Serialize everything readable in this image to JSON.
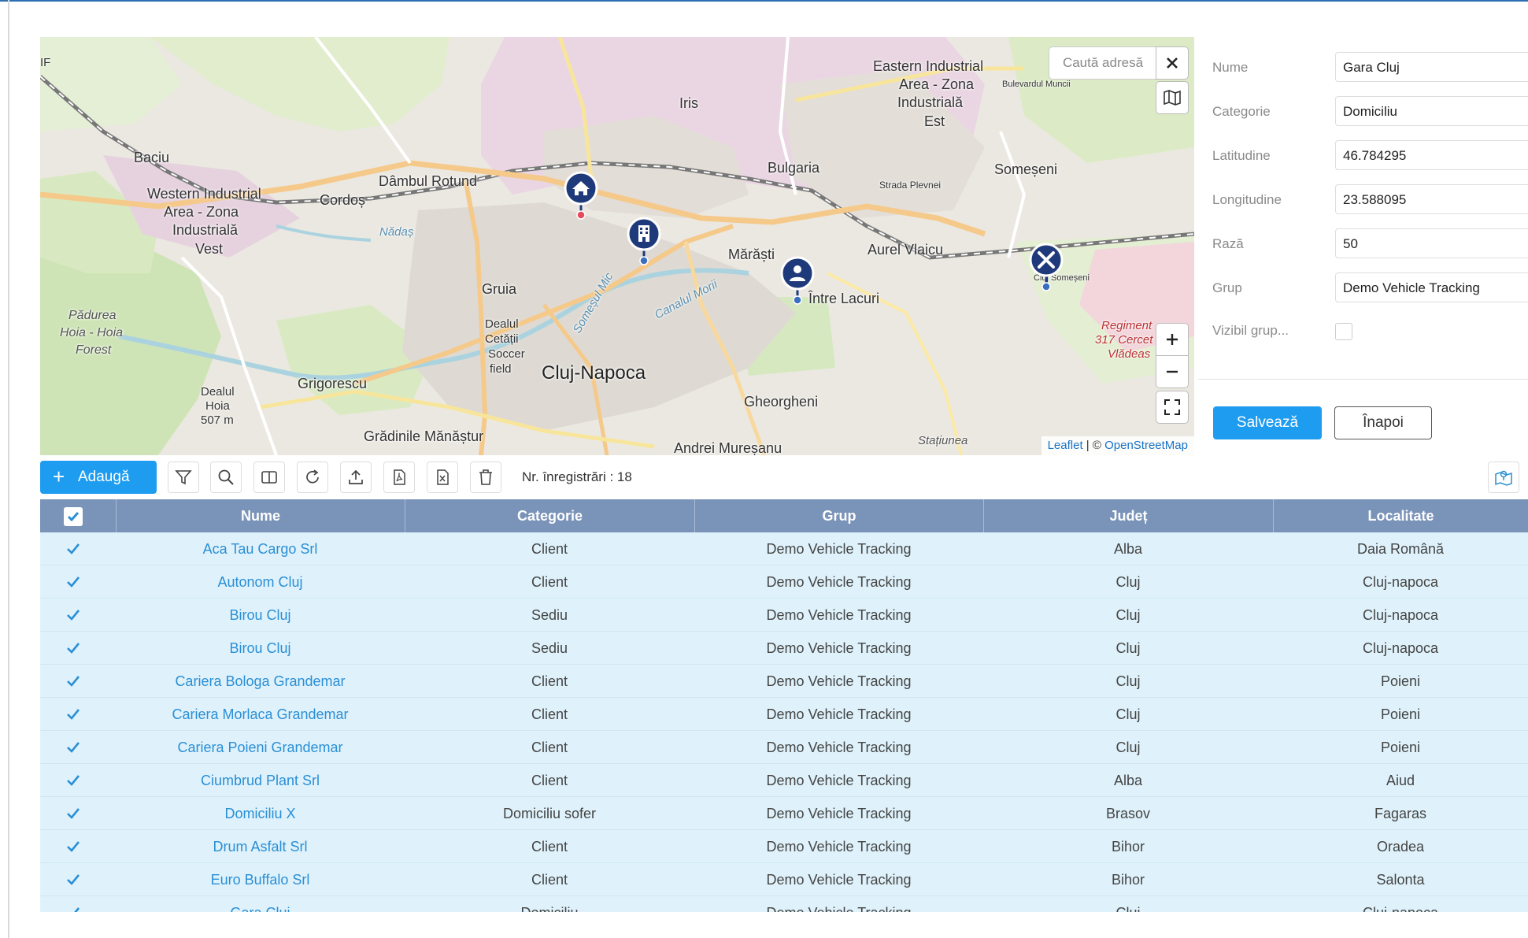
{
  "map": {
    "search_placeholder": "Caută adresă",
    "attribution_leaflet": "Leaflet",
    "attribution_sep": " | © ",
    "attribution_osm": "OpenStreetMap",
    "labels": {
      "eastern": "Eastern Industrial",
      "area_zona": "Area - Zona",
      "industriala": "Industrială",
      "est": "Est",
      "bulevardul": "Bulevardul Muncii",
      "iris": "Iris",
      "baciu": "Baciu",
      "western": "Western Industrial",
      "area_zona_w": "Area - Zona",
      "industriala_w": "Industrială",
      "vest": "Vest",
      "cordos": "Cordoș",
      "dambul": "Dâmbul Rotund",
      "nadas": "Nădaș",
      "bulgaria": "Bulgaria",
      "strada": "Strada Plevnei",
      "someseni": "Someșeni",
      "aurel": "Aurel Vlaicu",
      "marasti": "Mărăști",
      "intre_lacuri": "Între Lacuri",
      "gruia": "Gruia",
      "dealul": "Dealul",
      "cetatii": "Cetății",
      "soccer": "Soccer",
      "field": "field",
      "cluj": "Cluj-Napoca",
      "padurea": "Pădurea",
      "hoia": "Hoia - Hoia",
      "forest": "Forest",
      "grigorescu": "Grigorescu",
      "dealul_hoia": "Dealul",
      "hoia2": "Hoia",
      "alt": "507 m",
      "gradinile": "Grădinile Mănăștur",
      "gheorgheni": "Gheorgheni",
      "andrei": "Andrei Mureșanu",
      "regiment": "Regiment",
      "regiment2": "317 Cercet",
      "regiment3": "Vlădeas",
      "statiunea": "Stațiunea",
      "someseni_small": "Cluj Someșeni",
      "canal": "Canalul Morii",
      "somesul": "Someșul Mic",
      "if": "IF"
    }
  },
  "form": {
    "fields": [
      {
        "label": "Nume",
        "value": "Gara Cluj"
      },
      {
        "label": "Categorie",
        "value": "Domiciliu"
      },
      {
        "label": "Latitudine",
        "value": "46.784295"
      },
      {
        "label": "Longitudine",
        "value": "23.588095"
      },
      {
        "label": "Rază",
        "value": "50"
      },
      {
        "label": "Grup",
        "value": "Demo Vehicle Tracking"
      }
    ],
    "visible_label": "Vizibil grup...",
    "save_label": "Salvează",
    "back_label": "Înapoi"
  },
  "toolbar": {
    "add_label": "Adaugă",
    "record_count": "Nr. înregistrări : 18"
  },
  "table": {
    "headers": [
      "Nume",
      "Categorie",
      "Grup",
      "Județ",
      "Localitate"
    ],
    "rows": [
      [
        "Aca Tau Cargo Srl",
        "Client",
        "Demo Vehicle Tracking",
        "Alba",
        "Daia Română"
      ],
      [
        "Autonom Cluj",
        "Client",
        "Demo Vehicle Tracking",
        "Cluj",
        "Cluj-napoca"
      ],
      [
        "Birou Cluj",
        "Sediu",
        "Demo Vehicle Tracking",
        "Cluj",
        "Cluj-napoca"
      ],
      [
        "Birou Cluj",
        "Sediu",
        "Demo Vehicle Tracking",
        "Cluj",
        "Cluj-napoca"
      ],
      [
        "Cariera Bologa Grandemar",
        "Client",
        "Demo Vehicle Tracking",
        "Cluj",
        "Poieni"
      ],
      [
        "Cariera Morlaca Grandemar",
        "Client",
        "Demo Vehicle Tracking",
        "Cluj",
        "Poieni"
      ],
      [
        "Cariera Poieni Grandemar",
        "Client",
        "Demo Vehicle Tracking",
        "Cluj",
        "Poieni"
      ],
      [
        "Ciumbrud Plant Srl",
        "Client",
        "Demo Vehicle Tracking",
        "Alba",
        "Aiud"
      ],
      [
        "Domiciliu X",
        "Domiciliu sofer",
        "Demo Vehicle Tracking",
        "Brasov",
        "Fagaras"
      ],
      [
        "Drum Asfalt Srl",
        "Client",
        "Demo Vehicle Tracking",
        "Bihor",
        "Oradea"
      ],
      [
        "Euro Buffalo Srl",
        "Client",
        "Demo Vehicle Tracking",
        "Bihor",
        "Salonta"
      ],
      [
        "Gara Cluj",
        "Domiciliu",
        "Demo Vehicle Tracking",
        "Cluj",
        "Cluj-napoca"
      ]
    ]
  },
  "colors": {
    "accent": "#1e9cf0",
    "table_header": "#7a93b8",
    "row_bg": "#dff2fb",
    "link": "#2a8fd6",
    "pin": "#1f3a7a"
  },
  "icons": {
    "add": "plus-icon",
    "filter": "filter-icon",
    "search": "search-icon",
    "columns": "columns-icon",
    "refresh": "refresh-icon",
    "export": "export-icon",
    "pdf": "pdf-icon",
    "excel": "excel-icon",
    "delete": "trash-icon",
    "map_layers": "map-icon",
    "fullscreen": "fullscreen-icon",
    "close": "close-icon"
  }
}
